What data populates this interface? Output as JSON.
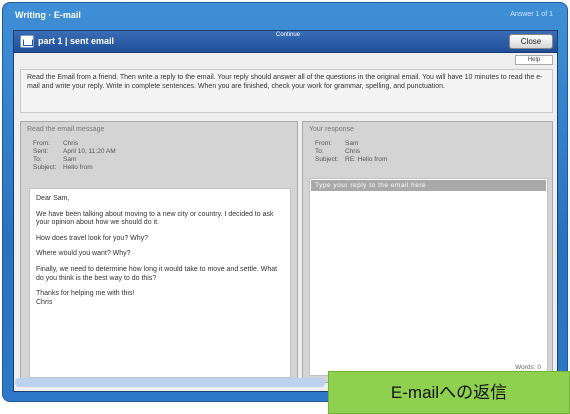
{
  "app": {
    "title": "Writing · E-mail",
    "time": "Answer 1 of 1"
  },
  "window": {
    "title": "part 1 | sent email",
    "center_label": "Continue",
    "close_label": "Close",
    "sub_tab": "Help"
  },
  "instructions": "Read the Email from a friend. Then write a reply to the email. Your reply should answer all of the questions in the original email. You will have 10 minutes to read the e-mail and write your reply. Write in complete sentences. When you are finished, check your work for grammar, spelling, and punctuation.",
  "left_pane": {
    "heading": "Read the email message",
    "meta": [
      {
        "key": "From:",
        "value": "Chris"
      },
      {
        "key": "Sent:",
        "value": "April 10, 11:20 AM"
      },
      {
        "key": "To:",
        "value": "Sam"
      },
      {
        "key": "Subject:",
        "value": "Hello from"
      }
    ],
    "body": [
      "Dear Sam,",
      "We have been talking about moving to a new city or country. I decided to ask your opinion about how we should do it.",
      "How does travel look for you? Why?",
      "Where would you want? Why?",
      "Finally, we need to determine how long it would take to move and settle. What do you think is the best way to do this?",
      "Thanks for helping me with this!\nChris"
    ]
  },
  "right_pane": {
    "heading": "Your response",
    "meta": [
      {
        "key": "From:",
        "value": "Sam"
      },
      {
        "key": "To:",
        "value": "Chris"
      },
      {
        "key": "Subject:",
        "value": "RE: Hello from"
      }
    ],
    "reply_text": "Type your reply to the email here",
    "word_count": "Words: 0"
  },
  "caption": "E-mailへの返信",
  "colors": {
    "frame_blue": "#2a72c0",
    "titlebar_blue": "#1f4f99",
    "caption_green": "#8fd14f"
  }
}
